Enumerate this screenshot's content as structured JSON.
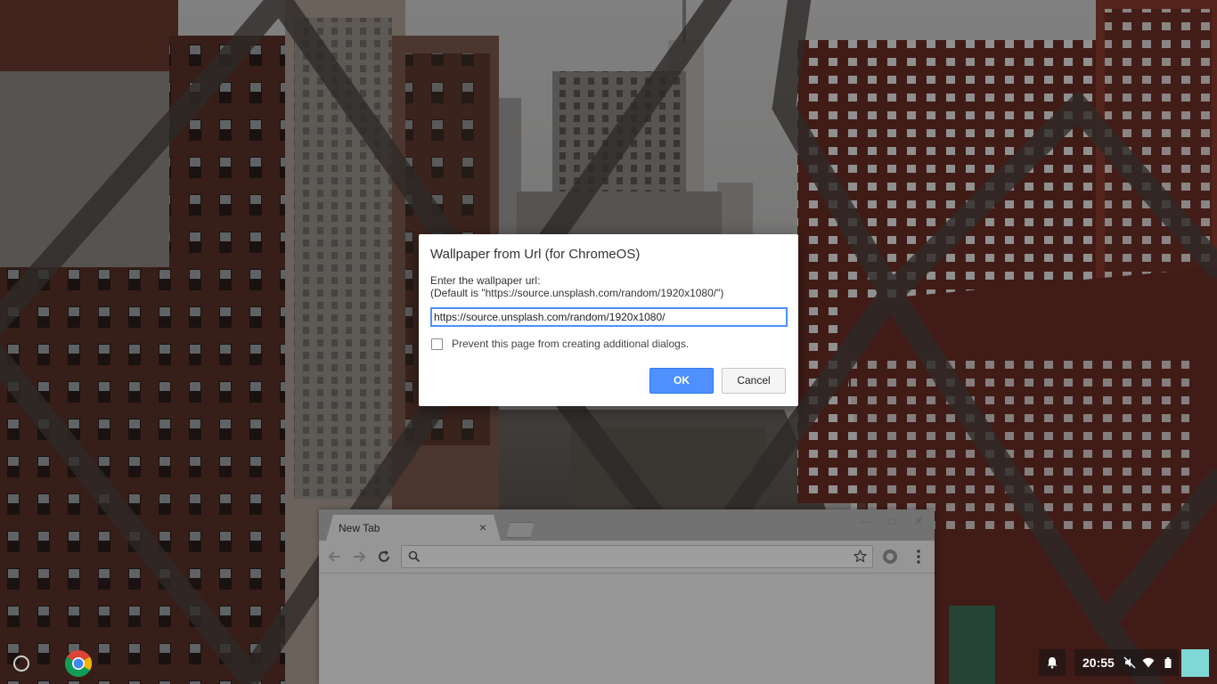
{
  "browser": {
    "tab_title": "New Tab",
    "tab_close": "×",
    "omnibox_placeholder": ""
  },
  "dialog": {
    "title": "Wallpaper from Url (for ChromeOS)",
    "message_line1": "Enter the wallpaper url:",
    "message_line2": "(Default is \"https://source.unsplash.com/random/1920x1080/\")",
    "input_value": "https://source.unsplash.com/random/1920x1080/",
    "checkbox_label": "Prevent this page from creating additional dialogs.",
    "checkbox_checked": false,
    "ok_label": "OK",
    "cancel_label": "Cancel"
  },
  "shelf": {
    "clock": "20:55",
    "icons": [
      "launcher-icon",
      "chrome-icon",
      "notification-bell-icon",
      "mute-icon",
      "wifi-icon",
      "battery-icon"
    ]
  },
  "colors": {
    "accent": "#4d90fe",
    "avatar": "#7fd8d6"
  }
}
